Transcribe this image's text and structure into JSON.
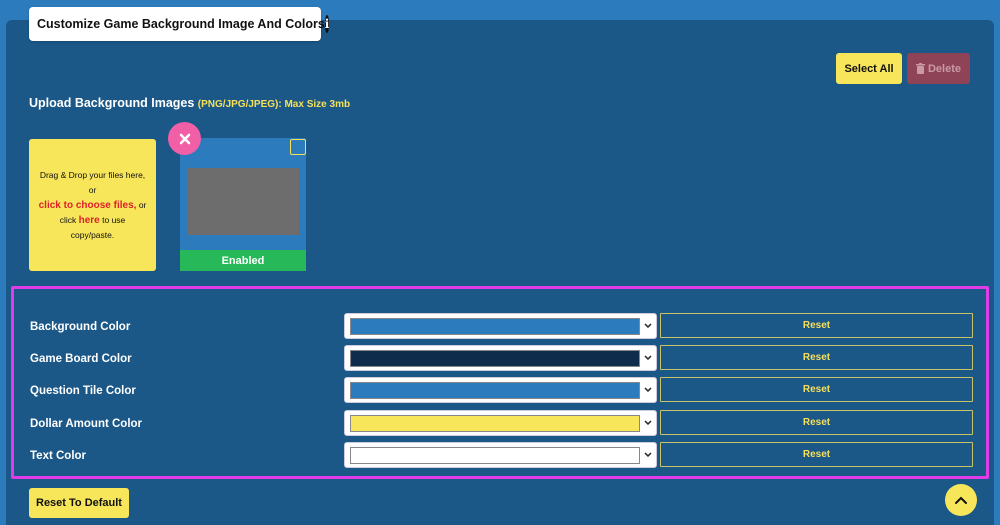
{
  "header": {
    "title": "Customize Game Background Image And Colors",
    "info_icon": "i"
  },
  "toolbar": {
    "select_all_label": "Select All",
    "delete_label": "Delete"
  },
  "upload": {
    "heading": "Upload Background Images",
    "hint": "(PNG/JPG/JPEG): Max Size 3mb",
    "dropzone": {
      "line1": "Drag & Drop your files here,",
      "line2": "or",
      "choose_link": "click to choose files,",
      "line3": "or",
      "line4_prefix": "click",
      "here_link": "here",
      "line4_suffix": "to use",
      "line5": "copy/paste."
    }
  },
  "images": [
    {
      "status": "Enabled"
    }
  ],
  "colors": [
    {
      "label": "Background Color",
      "value": "#2b7bbd",
      "reset_label": "Reset"
    },
    {
      "label": "Game Board Color",
      "value": "#0f2c4c",
      "reset_label": "Reset"
    },
    {
      "label": "Question Tile Color",
      "value": "#2b7bbd",
      "reset_label": "Reset"
    },
    {
      "label": "Dollar Amount Color",
      "value": "#f7e55a",
      "reset_label": "Reset"
    },
    {
      "label": "Text Color",
      "value": "#ffffff",
      "reset_label": "Reset"
    }
  ],
  "footer": {
    "reset_default_label": "Reset To Default"
  },
  "theme": {
    "page_bg": "#2b7bbd",
    "panel_bg": "#1b5888",
    "accent_yellow": "#f7e55a",
    "highlight_magenta": "#e23be8",
    "enabled_green": "#27b85a",
    "remove_pink": "#f15fa7"
  }
}
